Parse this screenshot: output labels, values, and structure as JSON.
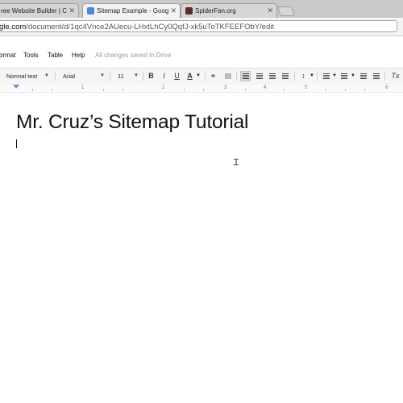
{
  "browser": {
    "tabs": [
      {
        "label": "ree Website Builder | Cre",
        "close": "✕",
        "favicon": "website-builder-favicon"
      },
      {
        "label": "Sitemap Example - Google",
        "close": "✕",
        "favicon": "google-docs-favicon"
      },
      {
        "label": "SpiderFan.org",
        "close": "✕",
        "favicon": "spiderfan-favicon"
      }
    ],
    "url_host": "gle.com",
    "url_path": "/document/d/1qc4Vnce2AUecu-LHxtLhCy0QqfJ-xk5uToTKFEEFObY/edit"
  },
  "menubar": {
    "items": [
      "ormat",
      "Tools",
      "Table",
      "Help"
    ],
    "save_status": "All changes saved in Drive"
  },
  "toolbar": {
    "style": "Normal text",
    "font": "Arial",
    "size": "11",
    "bold": "B",
    "italic": "I",
    "underline": "U",
    "text_color": "A",
    "clear_format": "Tx"
  },
  "ruler": {
    "numbers": [
      "1",
      "2",
      "3",
      "4",
      "5",
      "6"
    ]
  },
  "document": {
    "title": "Mr. Cruz’s Sitemap Tutorial"
  }
}
